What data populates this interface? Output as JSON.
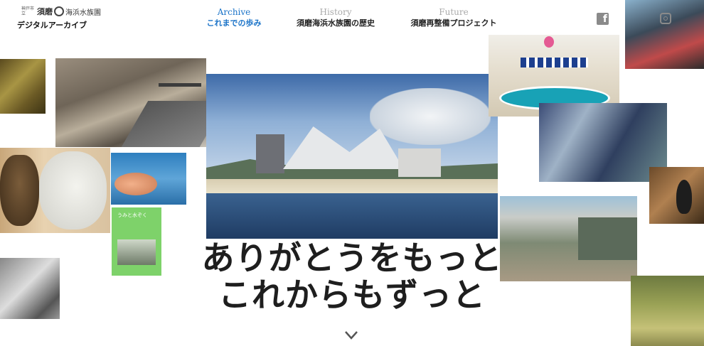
{
  "logo": {
    "small": "神戸市立",
    "name_part1": "須磨",
    "name_part2": "海浜水族園",
    "subtitle": "デジタルアーカイブ"
  },
  "nav": [
    {
      "en": "Archive",
      "jp": "これまでの歩み",
      "active": true
    },
    {
      "en": "History",
      "jp": "須磨海浜水族園の歴史",
      "active": false
    },
    {
      "en": "Future",
      "jp": "須磨再整備プロジェクト",
      "active": false
    }
  ],
  "social": {
    "facebook": "f",
    "instagram": "instagram-icon"
  },
  "book_title": "うみと水ぞく",
  "headline": {
    "line1": "ありがとうをもっと",
    "line2": "これからもずっと"
  },
  "icons": {
    "scroll": "chevron-down-icon"
  },
  "colors": {
    "accent": "#1a73c8",
    "muted": "#aaaaaa",
    "text": "#1e1e1e"
  }
}
